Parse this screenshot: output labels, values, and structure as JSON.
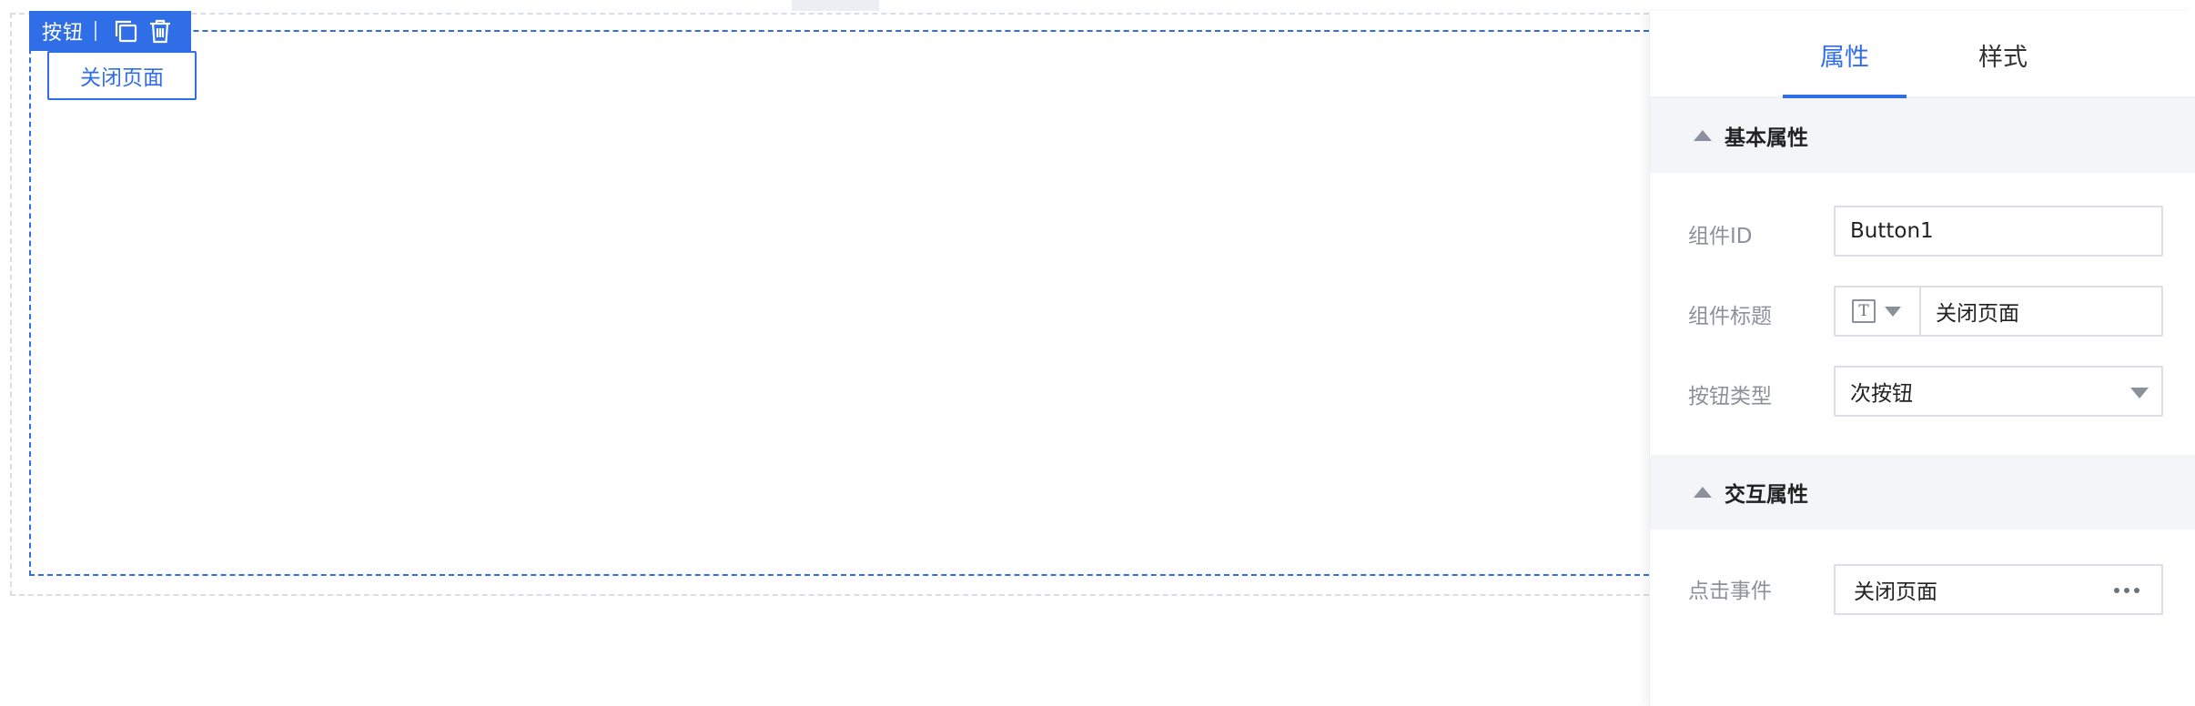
{
  "component_toolbar": {
    "label": "按钮",
    "copy_icon": "copy-icon",
    "delete_icon": "trash-icon"
  },
  "canvas": {
    "button_text": "关闭页面"
  },
  "panel": {
    "tabs": [
      {
        "label": "属性",
        "active": true
      },
      {
        "label": "样式",
        "active": false
      }
    ],
    "basic_section": {
      "title": "基本属性",
      "component_id_label": "组件ID",
      "component_id_value": "Button1",
      "component_title_label": "组件标题",
      "component_title_type_icon": "text-type-icon",
      "component_title_value": "关闭页面",
      "button_type_label": "按钮类型",
      "button_type_value": "次按钮"
    },
    "interaction_section": {
      "title": "交互属性",
      "click_event_label": "点击事件",
      "click_event_value": "关闭页面"
    }
  },
  "colors": {
    "accent": "#2f6ee6",
    "section_bg": "#f4f5f8",
    "label_gray": "#8c909a"
  }
}
